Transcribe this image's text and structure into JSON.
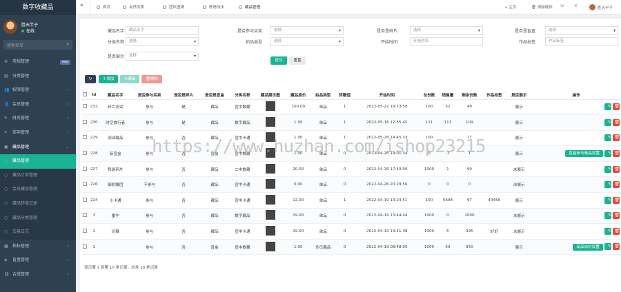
{
  "app": {
    "title": "数字收藏品"
  },
  "user": {
    "name": "胜天半子",
    "status": "在线"
  },
  "search": {
    "placeholder": "搜索菜单",
    "icon": "search-icon"
  },
  "sidebar": {
    "items": [
      {
        "label": "常规管理",
        "icon": "gear-icon",
        "badge": "new"
      },
      {
        "label": "分类管理",
        "icon": "folder-icon"
      },
      {
        "label": "权限管理",
        "icon": "users-icon"
      },
      {
        "label": "会员管理",
        "icon": "user-icon"
      },
      {
        "label": "财务管理",
        "icon": "money-icon"
      },
      {
        "label": "奖项管理",
        "icon": "gift-icon"
      },
      {
        "label": "藏品管理",
        "icon": "box-icon"
      },
      {
        "label": "藏品管理",
        "icon": "dot",
        "sub": true,
        "active": true
      },
      {
        "label": "藏品订单管理",
        "icon": "dot",
        "sub": true
      },
      {
        "label": "会员藏品管理",
        "icon": "dot",
        "sub": true
      },
      {
        "label": "藏品转增记录",
        "icon": "dot",
        "sub": true
      },
      {
        "label": "藏品分类管理",
        "icon": "dot",
        "sub": true
      },
      {
        "label": "交易日志",
        "icon": "dot",
        "sub": true
      },
      {
        "label": "指标管理",
        "icon": "chart-icon"
      },
      {
        "label": "盲盒管理",
        "icon": "cube-icon"
      },
      {
        "label": "合成管理",
        "icon": "link-icon"
      }
    ]
  },
  "topbar": {
    "menu_icon": "menu-icon",
    "tabs": [
      "首页",
      "会员列表",
      "团队图谱",
      "陈情浅水",
      "藏品管理"
    ],
    "right": [
      "主页",
      "清除缓存",
      "",
      ""
    ],
    "user_name": "胜天半子"
  },
  "filters": [
    {
      "label": "藏品名字",
      "placeholder": "藏品名字",
      "type": "text"
    },
    {
      "label": "是否参与买卖",
      "placeholder": "选择",
      "type": "select"
    },
    {
      "label": "是否是碎片",
      "placeholder": "选择",
      "type": "select"
    },
    {
      "label": "是否是盲盒",
      "placeholder": "选择",
      "type": "select"
    },
    {
      "label": "分类名称",
      "placeholder": "选择",
      "type": "select"
    },
    {
      "label": "拍品类型",
      "placeholder": "选择",
      "type": "select"
    },
    {
      "label": "开始时间",
      "placeholder": "开始时间",
      "type": "text"
    },
    {
      "label": "作品标签",
      "placeholder": "作品标签",
      "type": "text"
    },
    {
      "label": "是否展示",
      "placeholder": "选择",
      "type": "select"
    }
  ],
  "buttons": {
    "submit": "提交",
    "reset": "重置",
    "refresh": "",
    "add": "添加",
    "edit": "编辑",
    "delete": "删除"
  },
  "colors": {
    "primary": "#1ab394",
    "danger": "#e7473c",
    "sidebar": "#2f4050",
    "refresh": "#2f4050",
    "disabled_green": "#8fd9c7",
    "disabled_red": "#f19892"
  },
  "table": {
    "headers": [
      "",
      "Id",
      "藏品名字",
      "是否参与买卖",
      "是否是碎片",
      "是否是盲盒",
      "分类名称",
      "藏品展示图",
      "藏品原价",
      "拍品类型",
      "转赠值",
      "开始时间",
      "总份数",
      "销售量",
      "剩余份数",
      "作品标签",
      "是否展示",
      "操作"
    ],
    "rows": [
      {
        "id": "232",
        "name": "碎片测试",
        "trade": "参与",
        "frag": "是",
        "box": "藏品",
        "cat": "宣中数藏",
        "price": "100.00",
        "ptype": "单品",
        "gift": "1",
        "start": "2022-05-22 19:13:58",
        "total": "100",
        "sold": "52",
        "remain": "48",
        "tag": "",
        "show": "展示",
        "extra": ""
      },
      {
        "id": "230",
        "name": "时空旅行者",
        "trade": "参与",
        "frag": "是",
        "box": "藏品",
        "cat": "数字藏品",
        "price": "1.00",
        "ptype": "单品",
        "gift": "1",
        "start": "2022-05-18 12:55:45",
        "total": "111",
        "sold": "113",
        "remain": "109",
        "tag": "",
        "show": "展示",
        "extra": ""
      },
      {
        "id": "229",
        "name": "测试藏品",
        "trade": "参与",
        "frag": "否",
        "box": "藏品",
        "cat": "宣中卡通",
        "price": "1.00",
        "ptype": "单品",
        "gift": "1",
        "start": "2022-05-28 14:45:33",
        "total": "100",
        "sold": "",
        "remain": "77",
        "tag": "",
        "show": "展示",
        "extra": ""
      },
      {
        "id": "228",
        "name": "新盲盒",
        "trade": "参与",
        "frag": "否",
        "box": "盲盒",
        "cat": "宣中数藏",
        "price": "1.00",
        "ptype": "单品",
        "gift": "0",
        "start": "2022-04-26 14:01:34",
        "total": "0",
        "sold": "-1",
        "remain": "1",
        "tag": "",
        "show": "展示",
        "extra": "盲盒参与商品设置"
      },
      {
        "id": "227",
        "name": "我是碎片",
        "trade": "参与",
        "frag": "否",
        "box": "藏品",
        "cat": "二中数藏",
        "price": "20.00",
        "ptype": "单品",
        "gift": "0",
        "start": "2022-04-26 17:49:00",
        "total": "1000",
        "sold": "1",
        "remain": "99",
        "tag": "",
        "show": "未展示",
        "extra": ""
      },
      {
        "id": "226",
        "name": "御射雕团",
        "trade": "不参与",
        "frag": "否",
        "box": "藏品",
        "cat": "宣中卡通",
        "price": "0.00",
        "ptype": "单品",
        "gift": "0",
        "start": "2022-04-26 20:29:56",
        "total": "0",
        "sold": "0",
        "remain": "0",
        "tag": "",
        "show": "未展示",
        "extra": ""
      },
      {
        "id": "224",
        "name": "小卡通",
        "trade": "参与",
        "frag": "否",
        "box": "藏品",
        "cat": "宣中卡通",
        "price": "12.00",
        "ptype": "单品",
        "gift": "1",
        "start": "2022-04-19 13:23:51",
        "total": "100",
        "sold": "5698",
        "remain": "97",
        "tag": "44456",
        "show": "展示",
        "extra": ""
      },
      {
        "id": "3",
        "name": "董中",
        "trade": "参与",
        "frag": "否",
        "box": "藏品",
        "cat": "数字藏品",
        "price": "19.00",
        "ptype": "单品",
        "gift": "0",
        "start": "2022-04-19 13:44:44",
        "total": "1000",
        "sold": "0",
        "remain": "1000",
        "tag": "",
        "show": "未展示",
        "extra": ""
      },
      {
        "id": "2",
        "name": "珍藏",
        "trade": "参与",
        "frag": "否",
        "box": "藏品",
        "cat": "宣中卡通",
        "price": "19.00",
        "ptype": "单品",
        "gift": "0",
        "start": "2022-04-19 13:41:38",
        "total": "1000",
        "sold": "5",
        "remain": "995",
        "tag": "好好",
        "show": "未展示",
        "extra": ""
      },
      {
        "id": "1",
        "name": "",
        "trade": "参与",
        "frag": "否",
        "box": "盲盒",
        "cat": "宣中数藏",
        "price": "1.00",
        "ptype": "多日藏品",
        "gift": "0",
        "start": "2022-04-19 08:48:00",
        "total": "1000",
        "sold": "50",
        "remain": "950",
        "tag": "",
        "show": "展示",
        "extra": "商品自价设置"
      }
    ]
  },
  "footer": {
    "summary": "显示第 1 到第 10 条记录，总共 10 条记录"
  },
  "watermark": "https://www.huzhan.com/ishop23215"
}
